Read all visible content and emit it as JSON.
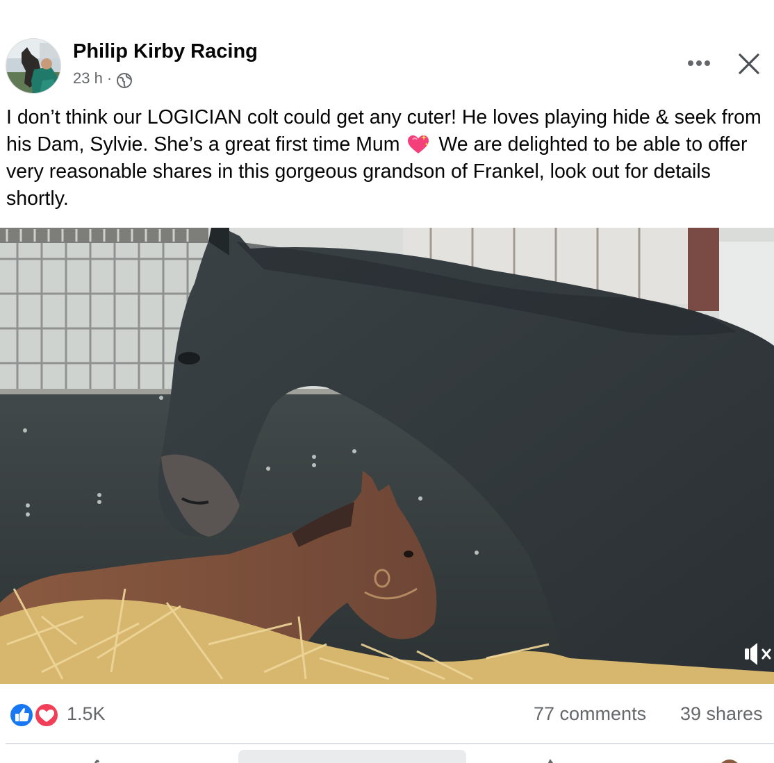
{
  "post": {
    "page_name": "Philip Kirby Racing",
    "time": "23 h",
    "separator": "·",
    "privacy_icon": "globe-icon",
    "more_icon": "more-horizontal-icon",
    "close_icon": "close-icon",
    "text_part1": "I don’t think our LOGICIAN colt could get any cuter! He loves playing hide & seek from his Dam, Sylvie. She’s a great first time Mum",
    "emoji": "sparkling-heart-emoji",
    "text_part2": "We are delighted to be able to offer very reasonable shares in this gorgeous grandson of Frankel, look out for details shortly."
  },
  "video": {
    "subject": "mare-and-foal-in-stable",
    "mute_icon": "speaker-muted-icon"
  },
  "stats": {
    "reactions": [
      "like-reaction-icon",
      "love-reaction-icon"
    ],
    "reaction_count": "1.5K",
    "comments": "77 comments",
    "shares": "39 shares"
  },
  "colors": {
    "like_blue": "#1877f2",
    "love_red": "#f33e58",
    "secondary_text": "#65676b",
    "divider": "#dadde1"
  }
}
